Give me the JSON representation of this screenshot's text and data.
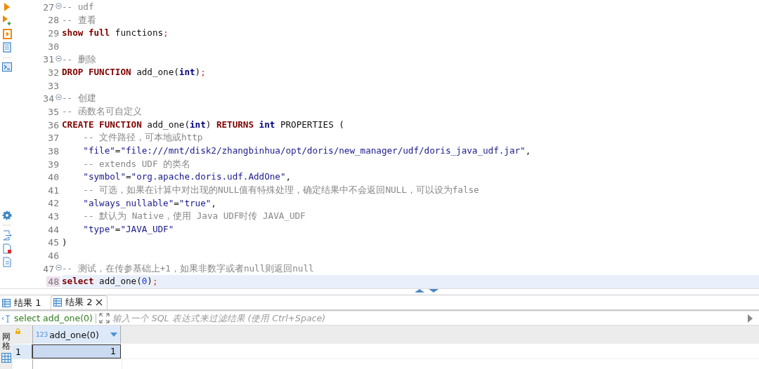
{
  "editor": {
    "lines": [
      {
        "number": "27",
        "foldable": true,
        "current": false,
        "tokens": [
          {
            "kind": "comment",
            "text": "-- udf"
          }
        ]
      },
      {
        "number": "28",
        "foldable": false,
        "current": false,
        "tokens": [
          {
            "kind": "comment",
            "text": "-- 查看"
          }
        ]
      },
      {
        "number": "29",
        "foldable": false,
        "current": false,
        "tokens": [
          {
            "kind": "keyword",
            "text": "show full"
          },
          {
            "kind": "plain",
            "text": " functions"
          },
          {
            "kind": "punct",
            "text": ";"
          }
        ]
      },
      {
        "number": "30",
        "foldable": false,
        "current": false
      },
      {
        "number": "31",
        "foldable": true,
        "current": false,
        "tokens": [
          {
            "kind": "comment",
            "text": "-- 删除"
          }
        ]
      },
      {
        "number": "32",
        "foldable": false,
        "current": false,
        "tokens": [
          {
            "kind": "keyword",
            "text": "DROP FUNCTION"
          },
          {
            "kind": "plain",
            "text": " add_one("
          },
          {
            "kind": "type",
            "text": "int"
          },
          {
            "kind": "plain",
            "text": ")"
          },
          {
            "kind": "punct",
            "text": ";"
          }
        ]
      },
      {
        "number": "33",
        "foldable": false,
        "current": false
      },
      {
        "number": "34",
        "foldable": true,
        "current": false,
        "tokens": [
          {
            "kind": "comment",
            "text": "-- 创建"
          }
        ]
      },
      {
        "number": "35",
        "foldable": false,
        "current": false,
        "tokens": [
          {
            "kind": "comment",
            "text": "-- 函数名可自定义"
          }
        ]
      },
      {
        "number": "36",
        "foldable": false,
        "current": false,
        "tokens": [
          {
            "kind": "keyword",
            "text": "CREATE FUNCTION"
          },
          {
            "kind": "plain",
            "text": " add_one("
          },
          {
            "kind": "type",
            "text": "int"
          },
          {
            "kind": "plain",
            "text": ") "
          },
          {
            "kind": "keyword",
            "text": "RETURNS"
          },
          {
            "kind": "type",
            "text": " int"
          },
          {
            "kind": "plain",
            "text": " PROPERTIES ("
          }
        ]
      },
      {
        "number": "37",
        "foldable": false,
        "current": false,
        "tokens": [
          {
            "kind": "comment",
            "text": "    -- 文件路径，可本地或http"
          }
        ]
      },
      {
        "number": "38",
        "foldable": false,
        "current": false,
        "tokens": [
          {
            "kind": "string",
            "text": "    \"file\""
          },
          {
            "kind": "plain",
            "text": "="
          },
          {
            "kind": "string",
            "text": "\"file:///mnt/disk2/zhangbinhua/opt/doris/new_manager/udf/doris_java_udf.jar\""
          },
          {
            "kind": "plain",
            "text": ","
          }
        ]
      },
      {
        "number": "39",
        "foldable": false,
        "current": false,
        "tokens": [
          {
            "kind": "comment",
            "text": "    -- extends UDF 的类名"
          }
        ]
      },
      {
        "number": "40",
        "foldable": false,
        "current": false,
        "tokens": [
          {
            "kind": "string",
            "text": "    \"symbol\""
          },
          {
            "kind": "plain",
            "text": "="
          },
          {
            "kind": "string",
            "text": "\"org.apache.doris.udf.AddOne\""
          },
          {
            "kind": "plain",
            "text": ","
          }
        ]
      },
      {
        "number": "41",
        "foldable": false,
        "current": false,
        "tokens": [
          {
            "kind": "comment",
            "text": "    -- 可选，如果在计算中对出现的NULL值有特殊处理，确定结果中不会返回NULL，可以设为false"
          }
        ]
      },
      {
        "number": "42",
        "foldable": false,
        "current": false,
        "tokens": [
          {
            "kind": "string",
            "text": "    \"always_nullable\""
          },
          {
            "kind": "plain",
            "text": "="
          },
          {
            "kind": "string",
            "text": "\"true\""
          },
          {
            "kind": "plain",
            "text": ","
          }
        ]
      },
      {
        "number": "43",
        "foldable": false,
        "current": false,
        "tokens": [
          {
            "kind": "comment",
            "text": "    -- 默认为 Native，使用 Java UDF时传 JAVA_UDF"
          }
        ]
      },
      {
        "number": "44",
        "foldable": false,
        "current": false,
        "tokens": [
          {
            "kind": "string",
            "text": "    \"type\""
          },
          {
            "kind": "plain",
            "text": "="
          },
          {
            "kind": "string",
            "text": "\"JAVA_UDF\""
          }
        ]
      },
      {
        "number": "45",
        "foldable": false,
        "current": false,
        "tokens": [
          {
            "kind": "plain",
            "text": ")"
          }
        ]
      },
      {
        "number": "46",
        "foldable": false,
        "current": false
      },
      {
        "number": "47",
        "foldable": true,
        "current": false,
        "tokens": [
          {
            "kind": "comment",
            "text": "-- 测试，在传参基础上+1，如果非数字或者null则返回null"
          }
        ]
      },
      {
        "number": "48",
        "foldable": false,
        "current": true,
        "tokens": [
          {
            "kind": "keyword",
            "text": "select"
          },
          {
            "kind": "plain",
            "text": " add_one("
          },
          {
            "kind": "number",
            "text": "0"
          },
          {
            "kind": "plain",
            "text": ")"
          },
          {
            "kind": "punct",
            "text": ";"
          }
        ]
      }
    ]
  },
  "result_tabs": [
    {
      "label": "结果 1",
      "selected": false
    },
    {
      "label": "结果 2",
      "selected": true,
      "closable": true
    }
  ],
  "filter_bar": {
    "query": "select add_one(0)",
    "placeholder": "输入一个 SQL 表达式来过滤结果 (使用 Ctrl+Space)"
  },
  "grid": {
    "side_label": "网格",
    "columns": [
      {
        "type_badge": "123",
        "name": "add_one(0)"
      }
    ],
    "rows": [
      {
        "number": "1",
        "selected": true,
        "cells": [
          "1"
        ]
      }
    ]
  }
}
